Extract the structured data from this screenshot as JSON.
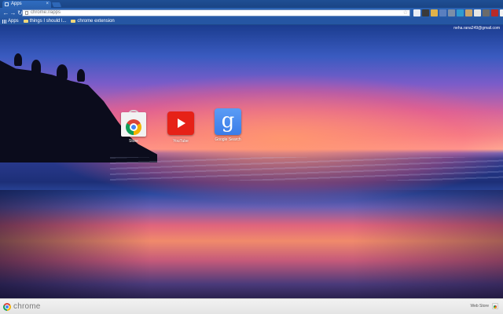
{
  "tab": {
    "title": "Apps"
  },
  "omnibox": {
    "url": "chrome://apps"
  },
  "bookmarks": [
    {
      "label": "Apps"
    },
    {
      "label": "things I should l..."
    },
    {
      "label": "chrome extension"
    }
  ],
  "user": {
    "email": "neha.rana249@gmail.com"
  },
  "apps": [
    {
      "label": "Store",
      "icon": "chrome-web-store-icon"
    },
    {
      "label": "YouTube",
      "icon": "youtube-icon"
    },
    {
      "label": "Google Search",
      "icon": "google-search-icon",
      "glyph": "g"
    }
  ],
  "footer": {
    "brand": "chrome",
    "webstore_label": "Web Store"
  },
  "colors": {
    "accent": "#2659a6",
    "youtube": "#e62117",
    "google_blue": "#4285f4"
  }
}
